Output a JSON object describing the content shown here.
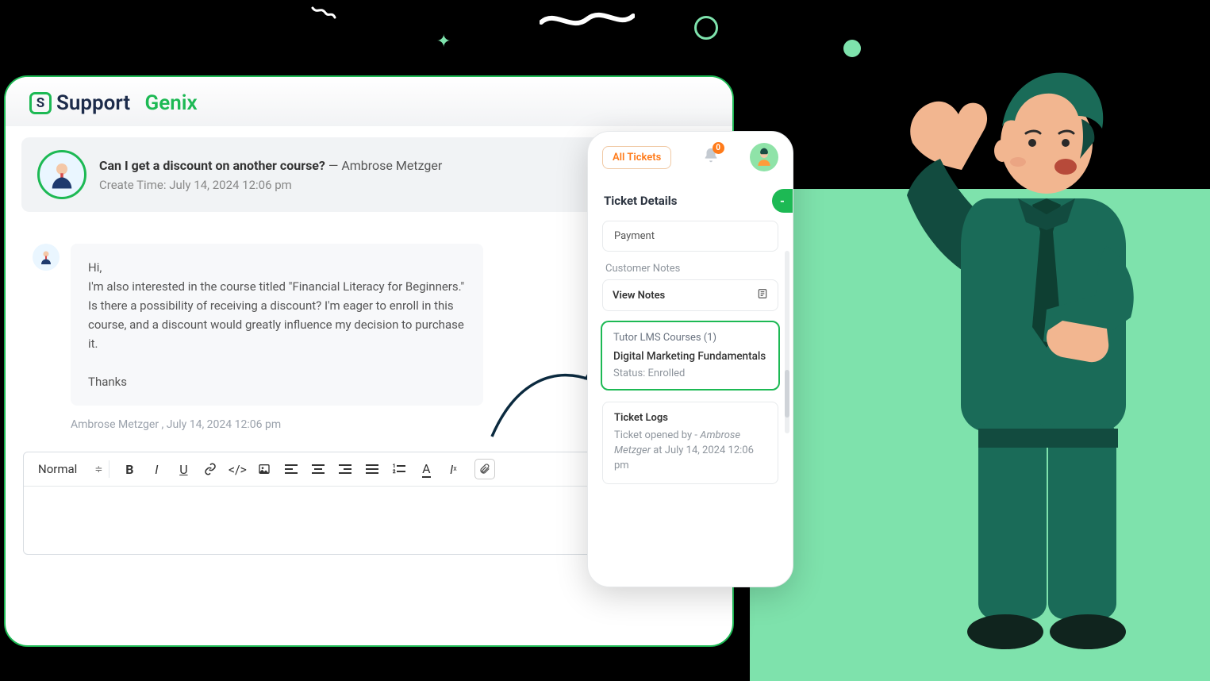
{
  "brand": {
    "name_a": "Support",
    "name_b": "Genix",
    "mark": "S"
  },
  "ticket": {
    "subject": "Can I get a discount on another course?",
    "sep": " — ",
    "author": "Ambrose Metzger",
    "create_label": "Create Time:",
    "create_value": "July 14, 2024 12:06 pm"
  },
  "message": {
    "greeting": "Hi,",
    "body": "I'm also interested in the course titled \"Financial Literacy for Beginners.\" Is there a possibility of receiving a discount? I'm eager to enroll in this course, and a discount would greatly influence my decision to purchase it.",
    "signoff": "Thanks",
    "meta": "Ambrose Metzger , July 14, 2024 12:06 pm"
  },
  "editor": {
    "format": "Normal"
  },
  "panel": {
    "all_tickets": "All Tickets",
    "notif_count": "0",
    "heading": "Ticket Details",
    "toggle": "-",
    "payment": "Payment",
    "notes_label": "Customer Notes",
    "view_notes": "View Notes",
    "course_box_title": "Tutor LMS Courses (1)",
    "course_name": "Digital Marketing Fundamentals",
    "course_status": "Status: Enrolled",
    "logs_title": "Ticket Logs",
    "log_prefix": "Ticket opened by - ",
    "log_author": "Ambrose Metzger",
    "log_suffix": " at July 14, 2024 12:06 pm"
  }
}
